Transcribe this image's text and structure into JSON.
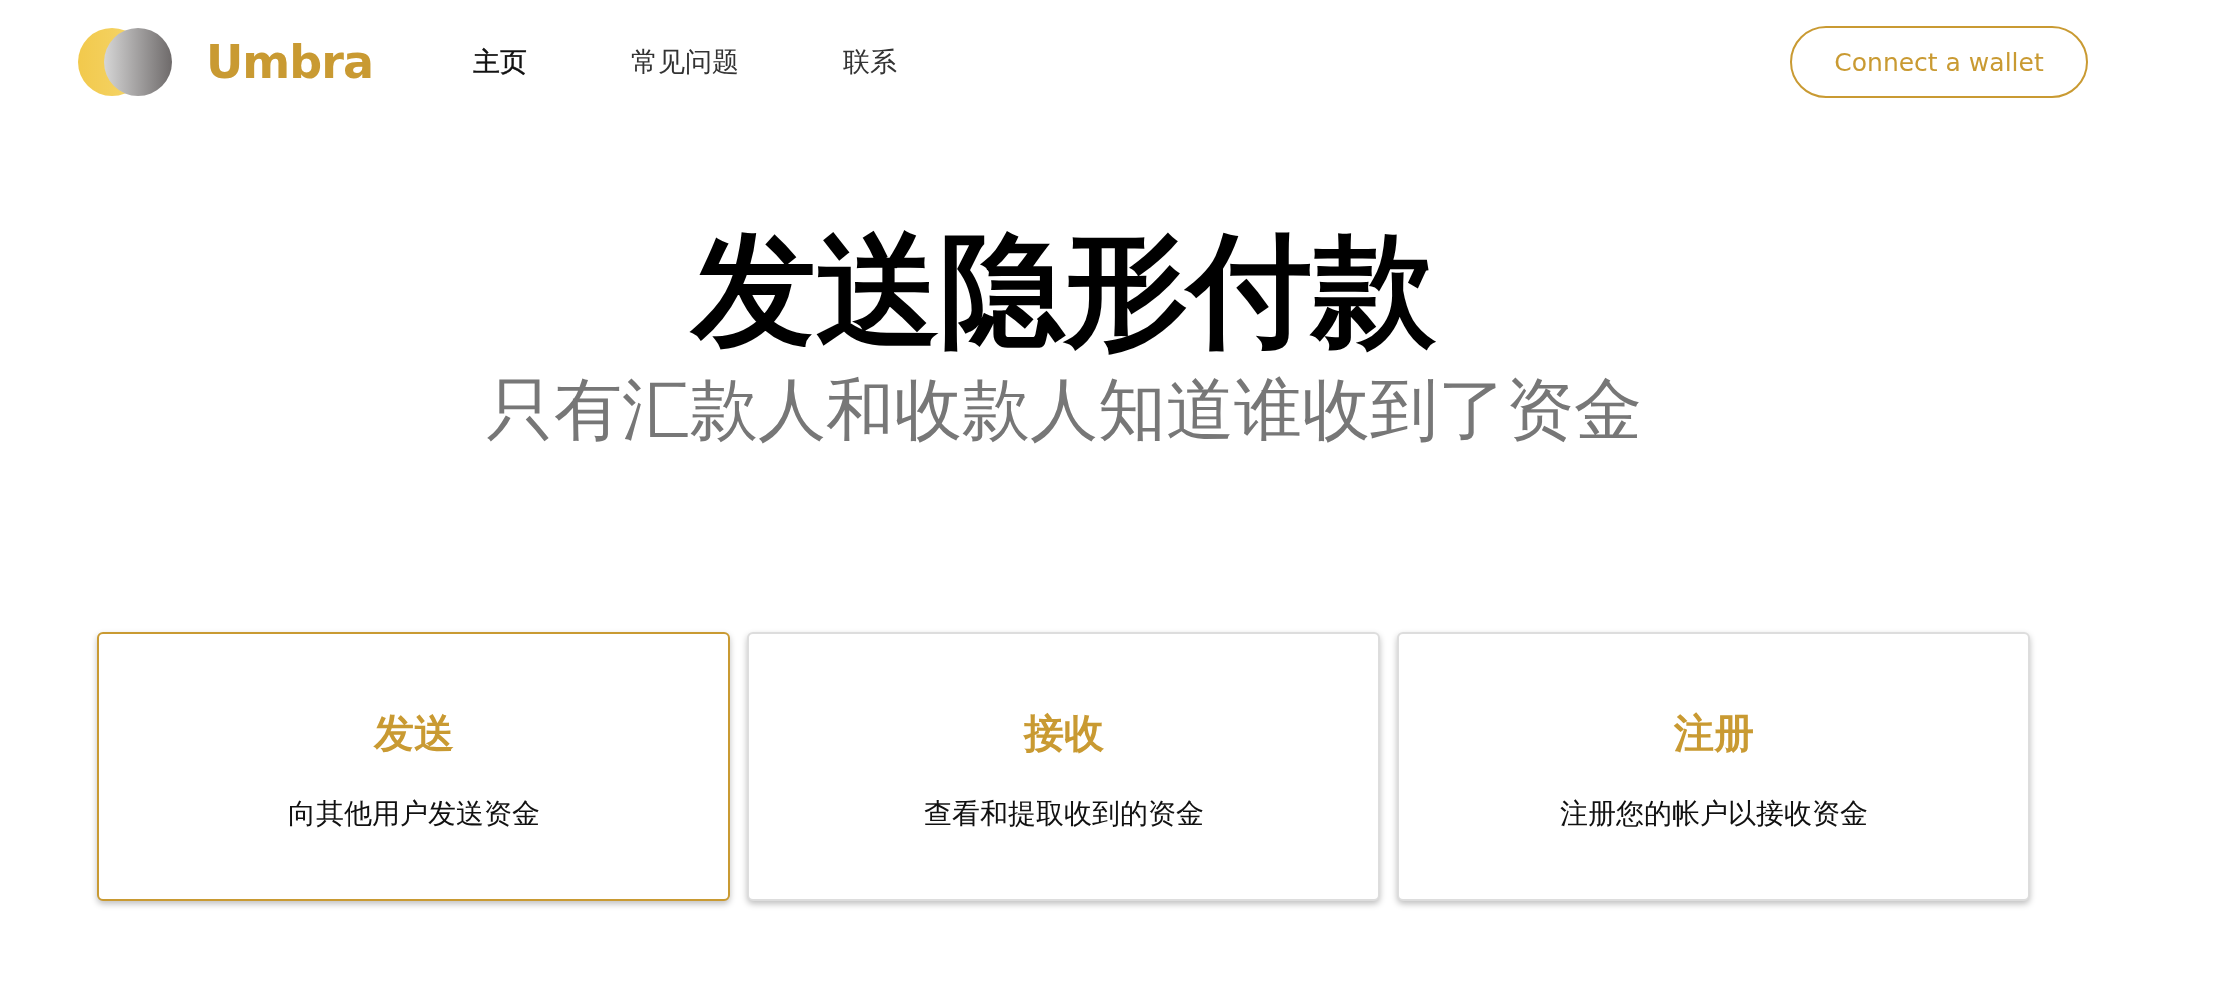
{
  "header": {
    "logo_text": "Umbra",
    "nav": [
      {
        "label": "主页",
        "selected": true
      },
      {
        "label": "常见问题",
        "selected": false
      },
      {
        "label": "联系",
        "selected": false
      }
    ],
    "connect_button": "Connect a wallet"
  },
  "hero": {
    "title": "发送隐形付款",
    "subtitle": "只有汇款人和收款人知道谁收到了资金"
  },
  "cards": [
    {
      "title": "发送",
      "description": "向其他用户发送资金",
      "selected": true
    },
    {
      "title": "接收",
      "description": "查看和提取收到的资金",
      "selected": false
    },
    {
      "title": "注册",
      "description": "注册您的帐户以接收资金",
      "selected": false
    }
  ]
}
